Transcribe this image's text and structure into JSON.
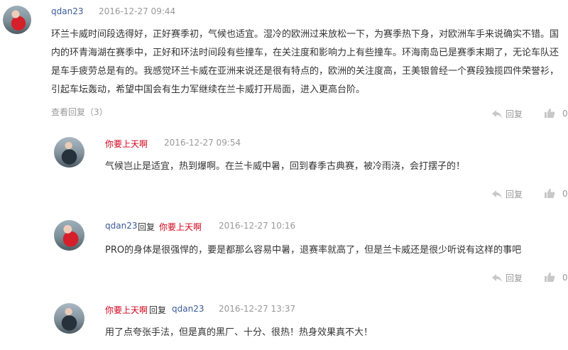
{
  "comments": [
    {
      "username": "qdan23",
      "time": "2016-12-27 09:44",
      "text": "环兰卡威时间段选得好，正好赛季初，气候也适宜。湿冷的欧洲过来放松一下，为赛季热下身，对欧洲车手来说确实不错。国内的环青海湖在赛季中，正好和环法时间段有些撞车，在关注度和影响力上有些撞车。环海南岛已是赛季末期了，无论车队还是车手疲劳总是有的。我感觉环兰卡威在亚洲来说还是很有特点的，欧洲的关注度高，王美银曾经一个赛段独揽四件荣誉衫，引起车坛轰动，希望中国会有生力军继续在兰卡威打开局面，进入更高台阶。",
      "view_replies": "查看回复（3）",
      "reply_label": "回复",
      "like_count": "0"
    },
    {
      "username": "你要上天啊",
      "time": "2016-12-27 09:54",
      "text": "气候岂止是适宜，热到爆啊。在兰卡威中暑，回到春季古典赛，被冷雨浇，会打摆子的！",
      "reply_label": "回复",
      "like_count": "0"
    },
    {
      "username": "qdan23",
      "reply_word": "回复",
      "reply_to": "你要上天啊",
      "time": "2016-12-27 10:16",
      "text": "PRO的身体是很强悍的，要是都那么容易中暑，退赛率就高了，但是兰卡威还是很少听说有这样的事吧",
      "reply_label": "回复",
      "like_count": "0"
    },
    {
      "username": "你要上天啊",
      "reply_word": "回复",
      "reply_to": "qdan23",
      "time": "2016-12-27 13:37",
      "text": "用了点夸张手法，但是真的黑厂、十分、很热！热身效果真不大！"
    }
  ],
  "icons": {
    "reply": "reply-arrow-icon",
    "like": "thumbs-up-icon"
  }
}
